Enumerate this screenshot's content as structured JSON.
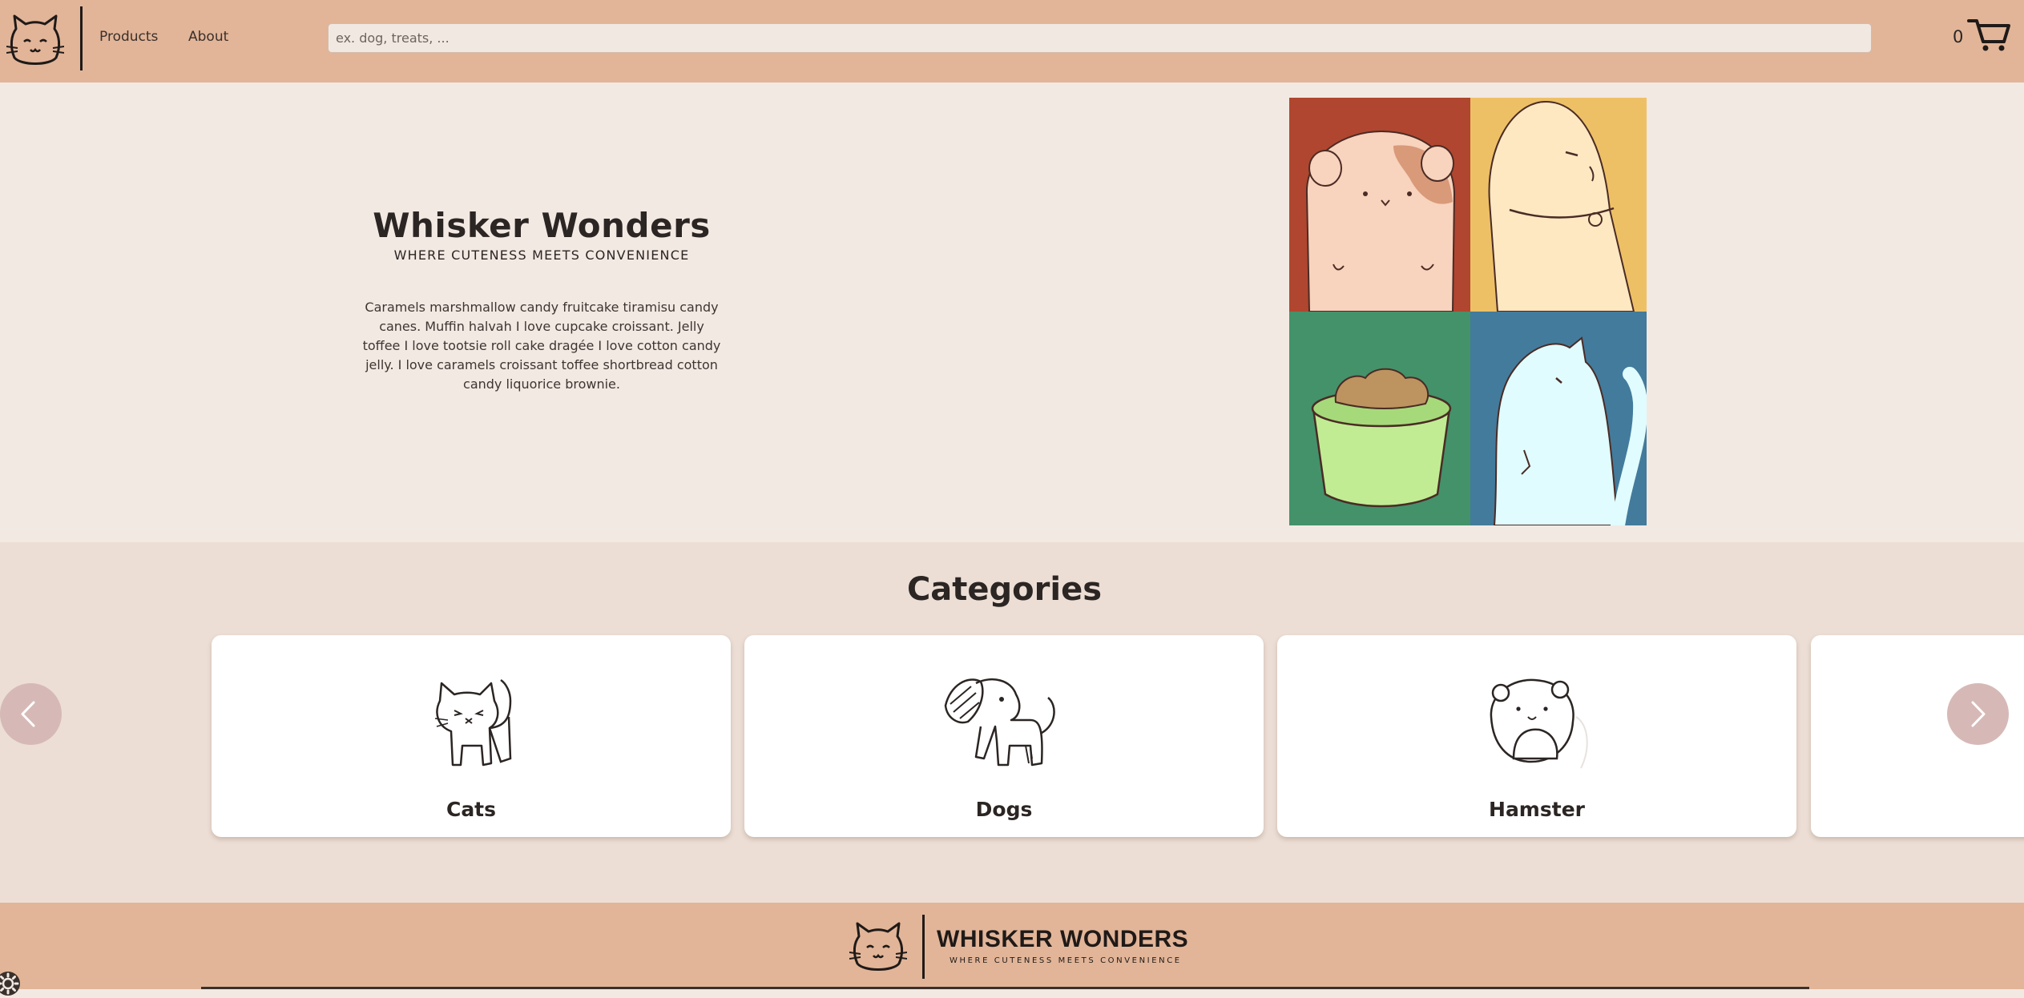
{
  "header": {
    "nav": [
      {
        "label": "Products"
      },
      {
        "label": "About"
      }
    ],
    "search_placeholder": "ex. dog, treats, ...",
    "cart_count": "0"
  },
  "hero": {
    "title": "Whisker Wonders",
    "subtitle": "WHERE CUTENESS MEETS CONVENIENCE",
    "body": "Caramels marshmallow candy fruitcake tiramisu candy canes. Muffin halvah I love cupcake croissant. Jelly toffee I love tootsie roll cake dragée I love cotton candy jelly. I love caramels croissant toffee shortbread cotton candy liquorice brownie.",
    "collage_colors": [
      "#b0462f",
      "#eec066",
      "#43926a",
      "#437b9c"
    ]
  },
  "categories": {
    "title": "Categories",
    "items": [
      {
        "label": "Cats",
        "icon": "cat-icon"
      },
      {
        "label": "Dogs",
        "icon": "dog-icon"
      },
      {
        "label": "Hamster",
        "icon": "hamster-icon"
      }
    ]
  },
  "footer": {
    "brand": "WHISKER WONDERS",
    "tagline": "WHERE CUTENESS MEETS CONVENIENCE"
  },
  "colors": {
    "header_bg": "#e2b598",
    "hero_bg": "#f3e9e3",
    "categories_bg": "#ecded5",
    "arrow_bg": "#d6b9b6"
  }
}
